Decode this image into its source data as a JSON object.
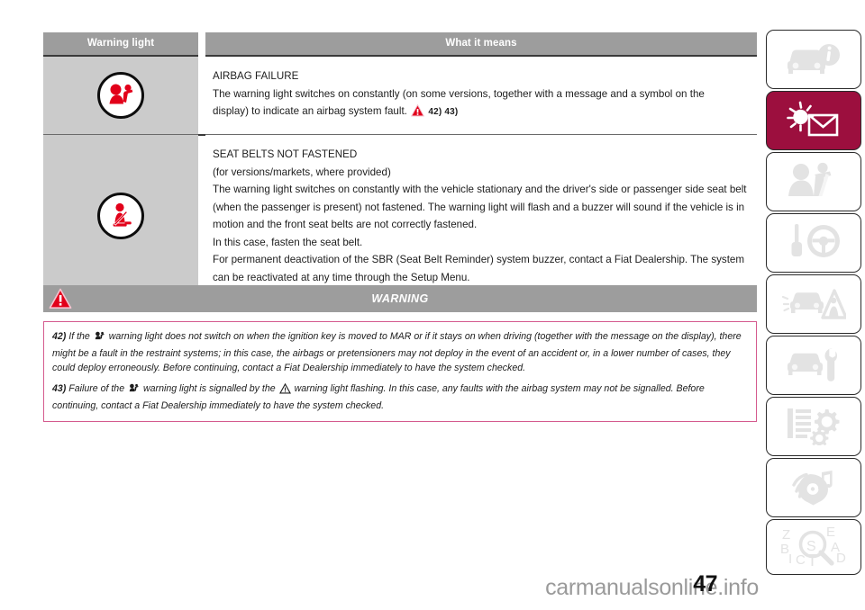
{
  "document": {
    "page_number": "47",
    "watermark": "carmanualsonline.info"
  },
  "table": {
    "headers": {
      "warning_light": "Warning light",
      "what_it_means": "What it means"
    },
    "rows": [
      {
        "icon_name": "airbag-failure-telltale-icon",
        "title": "AIRBAG FAILURE",
        "body_line_1": "The warning light switches on constantly (on some versions, together with a message and a symbol on the",
        "body_line_2": "display) to indicate an airbag system fault.",
        "references": "42) 43)"
      },
      {
        "icon_name": "seat-belt-telltale-icon",
        "title": "SEAT BELTS NOT FASTENED",
        "subtitle": "(for versions/markets, where provided)",
        "paragraph_1": "The warning light switches on constantly with the vehicle stationary and the driver's side or passenger side seat belt (when the passenger is present) not fastened. The warning light will flash and a buzzer will sound if the vehicle is in motion and the front seat belts are not correctly fastened.",
        "paragraph_2": "In this case, fasten the seat belt.",
        "paragraph_3": "For permanent deactivation of the SBR (Seat Belt Reminder) system buzzer, contact a Fiat Dealership. The system can be reactivated at any time through the Setup Menu."
      }
    ]
  },
  "warning_block": {
    "title": "WARNING",
    "notes": [
      {
        "number": "42)",
        "text_part_1": "If the",
        "text_part_2": "warning light does not switch on when the ignition key is moved to MAR or if it stays on when driving (together with the message on the display), there might be a fault in the restraint systems; in this case, the airbags or pretensioners may not deploy in the event of an accident or, in a lower number of cases, they could deploy erroneously. Before continuing, contact a Fiat Dealership immediately to have the system checked."
      },
      {
        "number": "43)",
        "text_part_1": "Failure of the",
        "text_part_2": "warning light is signalled by the",
        "text_part_3": "warning light flashing. In this case, any faults with the airbag system may not be signalled. Before continuing, contact a Fiat Dealership immediately to have the system checked."
      }
    ]
  },
  "side_rail": {
    "active_index": 1,
    "items": [
      {
        "icon_name": "car-info-icon",
        "label": "Dashboard and controls"
      },
      {
        "icon_name": "warning-lights-messages-icon",
        "label": "Warning lights and messages"
      },
      {
        "icon_name": "occupant-safety-icon",
        "label": "Safety"
      },
      {
        "icon_name": "key-steering-wheel-icon",
        "label": "Starting and driving"
      },
      {
        "icon_name": "emergency-breakdown-icon",
        "label": "In an emergency"
      },
      {
        "icon_name": "car-wrench-icon",
        "label": "Maintenance and care"
      },
      {
        "icon_name": "specifications-gears-icon",
        "label": "Technical specifications"
      },
      {
        "icon_name": "infotainment-music-icon",
        "label": "Multimedia"
      },
      {
        "icon_name": "alphabetical-index-icon",
        "label": "Alphabetical index"
      }
    ]
  },
  "colors": {
    "accent_red": "#9c0f3e",
    "header_gray": "#9d9d9d",
    "cell_gray": "#cbcbcb",
    "warn_border_pink": "#d45a8e",
    "telltale_red": "#e2001a"
  }
}
